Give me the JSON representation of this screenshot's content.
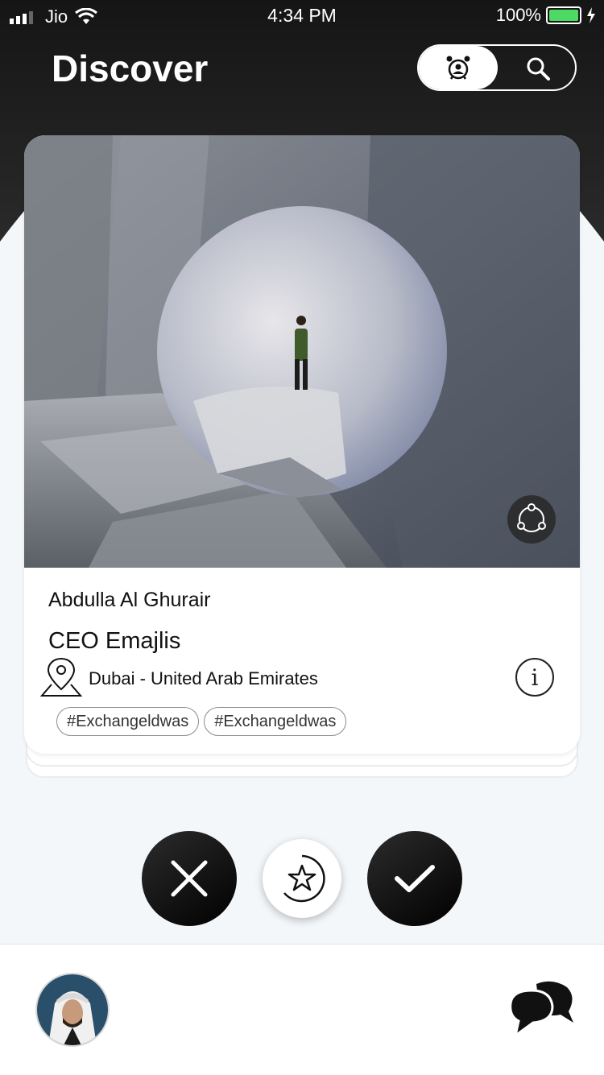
{
  "status_bar": {
    "carrier": "Jio",
    "time": "4:34 PM",
    "battery": "100%"
  },
  "header": {
    "title": "Discover",
    "toggle": {
      "active_icon": "contacts-alarm-icon",
      "other_icon": "search-icon"
    }
  },
  "profile": {
    "name": "Abdulla Al Ghurair",
    "role": "CEO Emajlis",
    "location": "Dubai - United Arab Emirates",
    "tags": [
      "#Exchangeldwas",
      "#Exchangeldwas"
    ]
  },
  "actions": {
    "reject_icon": "close-icon",
    "favorite_icon": "star-icon",
    "accept_icon": "check-icon"
  },
  "tabbar": {
    "left_icon": "avatar",
    "right_icon": "chat-bubbles-icon"
  },
  "colors": {
    "header": "#1a1a1a",
    "background": "#f4f7fa",
    "battery": "#4cd964",
    "accent_dark": "#111111"
  }
}
